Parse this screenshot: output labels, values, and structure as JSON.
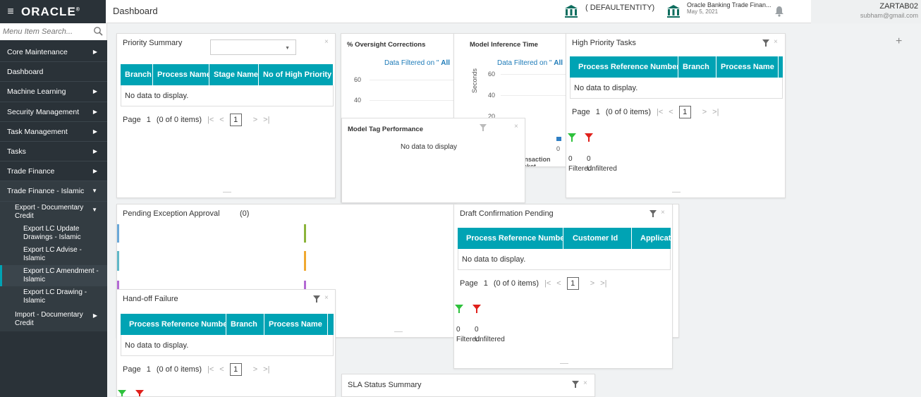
{
  "header": {
    "logo": "ORACLE",
    "page_title": "Dashboard",
    "entity": "( DEFAULTENTITY)",
    "app_name": "Oracle Banking Trade Finan...",
    "app_date": "May 5, 2021",
    "username": "ZARTAB02",
    "email": "subham@gmail.com"
  },
  "sidebar": {
    "search_placeholder": "Menu Item Search...",
    "items": [
      {
        "label": "Core Maintenance"
      },
      {
        "label": "Dashboard"
      },
      {
        "label": "Machine Learning"
      },
      {
        "label": "Security Management"
      },
      {
        "label": "Task Management"
      },
      {
        "label": "Tasks"
      },
      {
        "label": "Trade Finance"
      },
      {
        "label": "Trade Finance - Islamic"
      }
    ],
    "sub_export": "Export - Documentary Credit",
    "leaves": [
      "Export LC Update Drawings - Islamic",
      "Export LC Advise - Islamic",
      "Export LC Amendment - Islamic",
      "Export LC Drawing - Islamic"
    ],
    "sub_import": "Import - Documentary Credit"
  },
  "priority_summary": {
    "title": "Priority Summary",
    "columns": [
      "Branch",
      "Process Name",
      "Stage Name",
      "No of High Priority T"
    ],
    "empty": "No data to display.",
    "page_label": "Page",
    "page_num": "1",
    "items": "(0 of 0 items)",
    "current_page": "1"
  },
  "oversight": {
    "title": "% Oversight Corrections",
    "filter_text": "Data Filtered on \"",
    "filter_bold": "All",
    "ticks": [
      "60",
      "40"
    ]
  },
  "inference": {
    "title": "Model Inference Time",
    "filter_text": "Data Filtered on \"",
    "filter_bold": "All",
    "ticks": [
      "60",
      "40",
      "20"
    ],
    "ylabel": "Seconds",
    "x_zero": "0",
    "xlabel": "Transaction Bucket"
  },
  "tag_perf": {
    "title": "Model Tag Performance",
    "empty": "No data to display"
  },
  "high_priority": {
    "title": "High Priority Tasks",
    "columns": [
      "Process Reference Number",
      "Branch",
      "Process Name"
    ],
    "empty": "No data to display.",
    "page_label": "Page",
    "page_num": "1",
    "items": "(0 of 0 items)",
    "current_page": "1",
    "filtered_count": "0",
    "unfiltered_count": "0",
    "filtered_label": "Filtered",
    "unfiltered_label": "Unfiltered"
  },
  "pending_exception": {
    "title": "Pending Exception Approval",
    "count": "(0)"
  },
  "draft_confirmation": {
    "title": "Draft Confirmation Pending",
    "columns": [
      "Process Reference Number",
      "Customer Id",
      "Applicat"
    ],
    "empty": "No data to display.",
    "page_label": "Page",
    "page_num": "1",
    "items": "(0 of 0 items)",
    "current_page": "1",
    "filtered_count": "0",
    "unfiltered_count": "0",
    "filtered_label": "Filtered",
    "unfiltered_label": "Unfiltered"
  },
  "handoff": {
    "title": "Hand-off Failure",
    "columns": [
      "Process Reference Number",
      "Branch",
      "Process Name"
    ],
    "empty": "No data to display.",
    "page_label": "Page",
    "page_num": "1",
    "items": "(0 of 0 items)",
    "current_page": "1"
  },
  "sla": {
    "title": "SLA Status Summary"
  },
  "colors": {
    "teal": "#00a3b4",
    "sidebar": "#2a3238",
    "funnel_green": "#2ec13c",
    "funnel_red": "#e0201b",
    "accent_blue": "#6aa8d8",
    "accent_green": "#8bb43a",
    "accent_teal": "#5fb8c8",
    "accent_orange": "#f0a830",
    "accent_purple": "#b36ad4"
  }
}
